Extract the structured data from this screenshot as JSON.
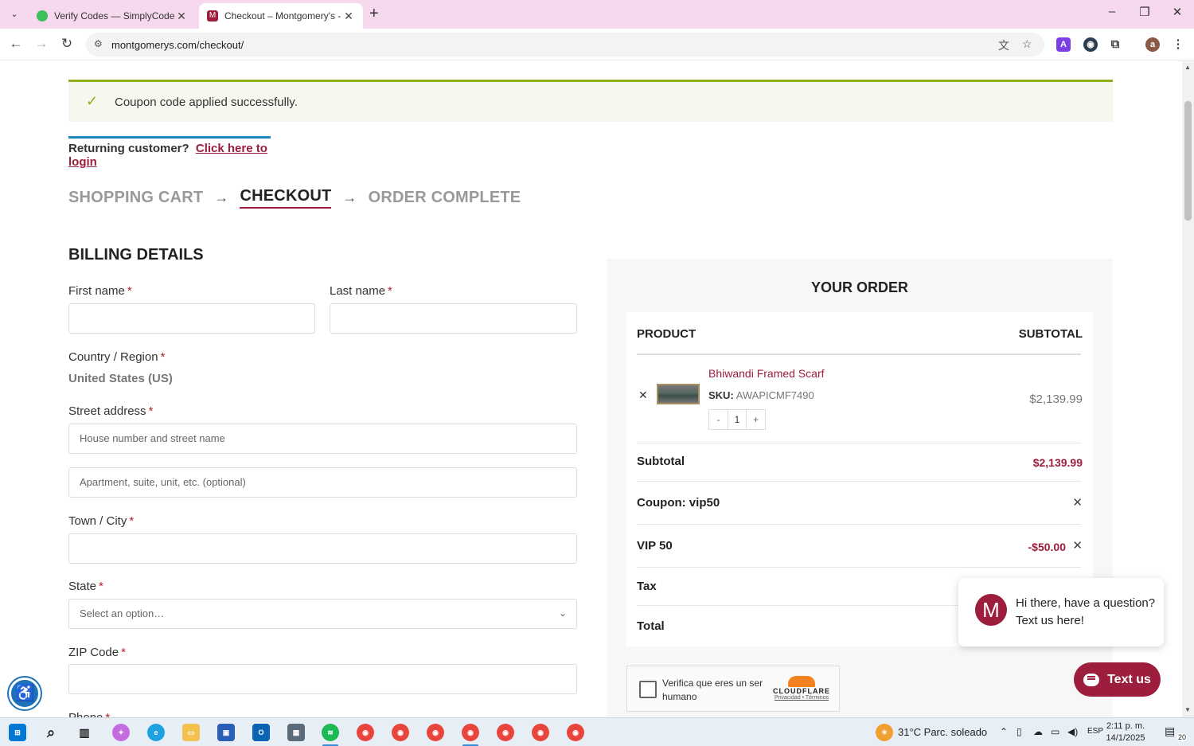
{
  "browser": {
    "tabs": [
      {
        "title": "Verify Codes — SimplyCodes",
        "active": false,
        "favicon_color": "#3dbf5a"
      },
      {
        "title": "Checkout – Montgomery's - Lo",
        "active": true,
        "favicon_color": "#9c1d3c",
        "favicon_letter": "M"
      }
    ],
    "url": "montgomerys.com/checkout/",
    "window_controls": {
      "minimize": "–",
      "maximize": "❐",
      "close": "✕"
    }
  },
  "notice": {
    "text": "Coupon code applied successfully."
  },
  "returning": {
    "prefix": "Returning customer?",
    "link": "Click here to login"
  },
  "steps": [
    {
      "label": "SHOPPING CART",
      "current": false
    },
    {
      "label": "CHECKOUT",
      "current": true
    },
    {
      "label": "ORDER COMPLETE",
      "current": false
    }
  ],
  "billing": {
    "title": "BILLING DETAILS",
    "first_name_label": "First name",
    "last_name_label": "Last name",
    "country_label": "Country / Region",
    "country_value": "United States (US)",
    "street_label": "Street address",
    "street_placeholder": "House number and street name",
    "apt_placeholder": "Apartment, suite, unit, etc. (optional)",
    "city_label": "Town / City",
    "state_label": "State",
    "state_placeholder": "Select an option…",
    "zip_label": "ZIP Code",
    "phone_label": "Phone",
    "required_mark": "*"
  },
  "order": {
    "title": "YOUR ORDER",
    "col_product": "PRODUCT",
    "col_subtotal": "SUBTOTAL",
    "item": {
      "name": "Bhiwandi Framed Scarf",
      "sku_label": "SKU:",
      "sku": "AWAPICMF7490",
      "qty": "1",
      "qty_minus": "-",
      "qty_plus": "+",
      "price": "$2,139.99"
    },
    "subtotal_label": "Subtotal",
    "subtotal_value": "$2,139.99",
    "coupon_label": "Coupon: vip50",
    "discount_label": "VIP 50",
    "discount_value": "-$50.00",
    "tax_label": "Tax",
    "total_label": "Total"
  },
  "turnstile": {
    "text": "Verifica que eres un ser humano",
    "brand": "CLOUDFLARE",
    "links": "Privacidad • Términos"
  },
  "chat": {
    "message": "Hi there, have a question? Text us here!",
    "button": "Text us",
    "avatar_letter": "M"
  },
  "taskbar": {
    "weather": "31°C  Parc. soleado",
    "lang": "ESP",
    "time": "2:11 p. m.",
    "date": "14/1/2025",
    "notifications": "20"
  },
  "colors": {
    "accent": "#9c1d3c",
    "success": "#8fae1b",
    "link_blue": "#1e85be"
  }
}
